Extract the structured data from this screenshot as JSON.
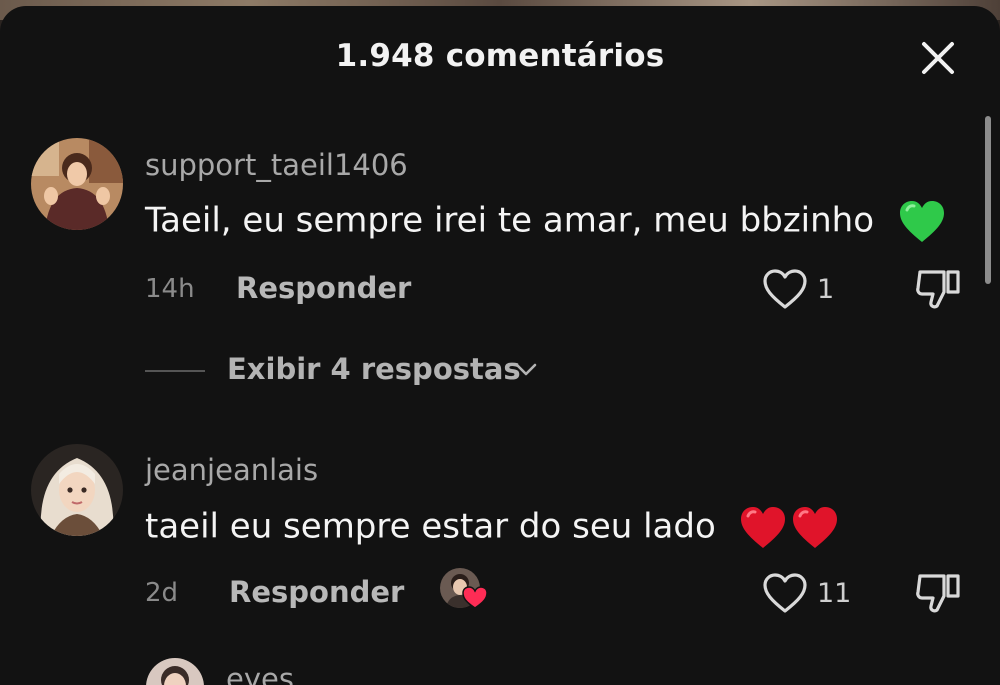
{
  "header": {
    "title": "1.948 comentários"
  },
  "comments": [
    {
      "username": "support_taeil1406",
      "text": "Taeil, eu sempre irei te amar, meu bbzinho",
      "emoji": "green-heart",
      "time": "14h",
      "reply_label": "Responder",
      "likes": "1",
      "view_replies": "Exibir 4 respostas"
    },
    {
      "username": "jeanjeanlais",
      "text": "taeil eu sempre estar do seu lado",
      "emoji": "red-heart-x2",
      "time": "2d",
      "reply_label": "Responder",
      "likes": "11",
      "liked_by_creator": true
    },
    {
      "username": "eyes"
    }
  ],
  "colors": {
    "sheet_bg": "#121212",
    "text_primary": "#f4f4f4",
    "text_secondary": "#a8a8a8",
    "green_heart": "#2fc94a",
    "red_heart": "#e0142a"
  }
}
